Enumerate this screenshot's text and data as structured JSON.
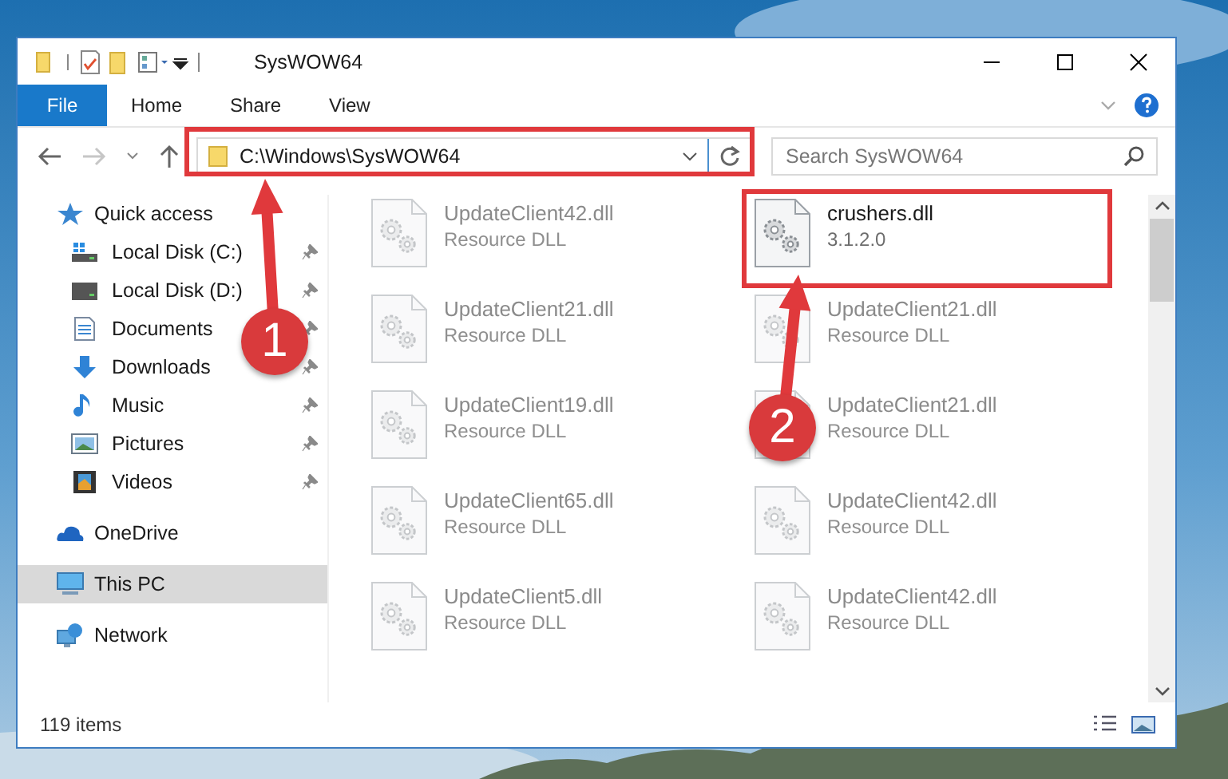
{
  "window": {
    "title": "SysWOW64"
  },
  "ribbon": {
    "tabs": [
      {
        "label": "File",
        "kind": "file"
      },
      {
        "label": "Home",
        "kind": "tab"
      },
      {
        "label": "Share",
        "kind": "tab"
      },
      {
        "label": "View",
        "kind": "tab"
      }
    ]
  },
  "address_bar": {
    "path": "C:\\Windows\\SysWOW64"
  },
  "search": {
    "placeholder": "Search SysWOW64"
  },
  "navigation": [
    {
      "label": "Quick access",
      "kind": "star",
      "selected": false,
      "children": [
        {
          "label": "Local Disk (C:)",
          "kind": "system-drive",
          "pinned": true
        },
        {
          "label": "Local Disk (D:)",
          "kind": "drive",
          "pinned": true
        },
        {
          "label": "Documents",
          "kind": "documents",
          "pinned": true
        },
        {
          "label": "Downloads",
          "kind": "downloads",
          "pinned": true
        },
        {
          "label": "Music",
          "kind": "music",
          "pinned": true
        },
        {
          "label": "Pictures",
          "kind": "pictures",
          "pinned": true
        },
        {
          "label": "Videos",
          "kind": "videos",
          "pinned": true
        }
      ]
    },
    {
      "label": "OneDrive",
      "kind": "cloud",
      "selected": false
    },
    {
      "label": "This PC",
      "kind": "computer",
      "selected": true
    },
    {
      "label": "Network",
      "kind": "network",
      "selected": false
    }
  ],
  "files": [
    {
      "name": "UpdateClient42.dll",
      "detail": "Resource DLL",
      "blurred": true
    },
    {
      "name": "crushers.dll",
      "detail": "3.1.2.0",
      "blurred": false
    },
    {
      "name": "UpdateClient21.dll",
      "detail": "Resource DLL",
      "blurred": true
    },
    {
      "name": "UpdateClient21.dll",
      "detail": "Resource DLL",
      "blurred": true
    },
    {
      "name": "UpdateClient19.dll",
      "detail": "Resource DLL",
      "blurred": true
    },
    {
      "name": "UpdateClient21.dll",
      "detail": "Resource DLL",
      "blurred": true
    },
    {
      "name": "UpdateClient65.dll",
      "detail": "Resource DLL",
      "blurred": true
    },
    {
      "name": "UpdateClient42.dll",
      "detail": "Resource DLL",
      "blurred": true
    },
    {
      "name": "UpdateClient5.dll",
      "detail": "Resource DLL",
      "blurred": true
    },
    {
      "name": "UpdateClient42.dll",
      "detail": "Resource DLL",
      "blurred": true
    }
  ],
  "status_bar": {
    "item_count": "119 items"
  },
  "annotations": [
    {
      "number": "1"
    },
    {
      "number": "2"
    }
  ]
}
